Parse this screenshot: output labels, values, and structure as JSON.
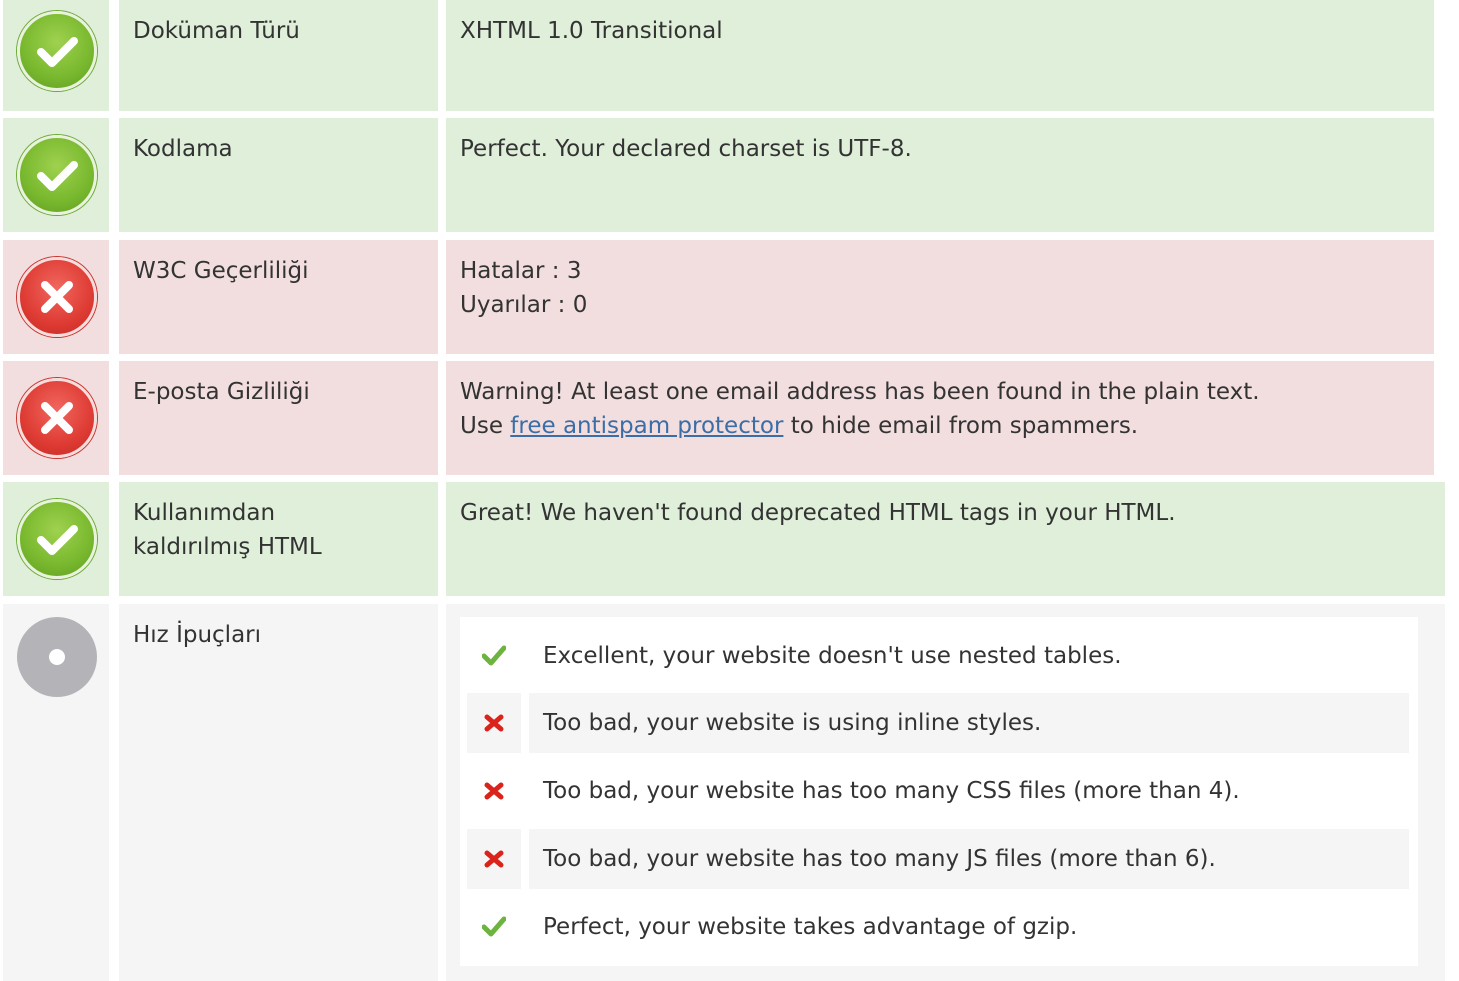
{
  "rows": [
    {
      "status": "ok",
      "status_icon": "check-circle-icon",
      "label": "Doküman Türü",
      "value": "XHTML 1.0 Transitional"
    },
    {
      "status": "ok",
      "status_icon": "check-circle-icon",
      "label": "Kodlama",
      "value": "Perfect. Your declared charset is UTF-8."
    },
    {
      "status": "error",
      "status_icon": "x-circle-icon",
      "label": "W3C Geçerliliği",
      "value_line1": "Hatalar : 3",
      "value_line2": "Uyarılar : 0"
    },
    {
      "status": "error",
      "status_icon": "x-circle-icon",
      "label": "E-posta Gizliliği",
      "value_line1": "Warning! At least one email address has been found in the plain text.",
      "value_prefix": "Use ",
      "link_text": "free antispam protector",
      "value_suffix": " to hide email from spammers."
    },
    {
      "status": "ok",
      "status_icon": "check-circle-icon",
      "label": "Kullanımdan kaldırılmış HTML",
      "value": "Great! We haven't found deprecated HTML tags in your HTML."
    },
    {
      "status": "info",
      "status_icon": "neutral-dot-icon",
      "label": "Hız İpuçları"
    }
  ],
  "tips": [
    {
      "status": "pass",
      "icon": "checkmark-icon",
      "text": "Excellent, your website doesn't use nested tables."
    },
    {
      "status": "fail",
      "icon": "cross-icon",
      "text": "Too bad, your website is using inline styles."
    },
    {
      "status": "fail",
      "icon": "cross-icon",
      "text": "Too bad, your website has too many CSS files (more than 4)."
    },
    {
      "status": "fail",
      "icon": "cross-icon",
      "text": "Too bad, your website has too many JS files (more than 6)."
    },
    {
      "status": "pass",
      "icon": "checkmark-icon",
      "text": "Perfect, your website takes advantage of gzip."
    }
  ],
  "colors": {
    "ok_bg": "#dfefd9",
    "error_bg": "#f2dedf",
    "neutral_bg": "#f5f5f5",
    "check_green": "#6cb33f",
    "cross_red": "#d9231b",
    "link": "#3b6ea6"
  }
}
